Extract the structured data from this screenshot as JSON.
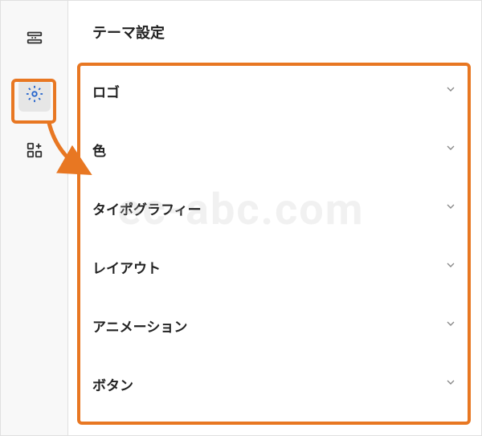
{
  "sidebar": {
    "items": [
      {
        "name": "sections",
        "active": false
      },
      {
        "name": "settings",
        "active": true
      },
      {
        "name": "add-block",
        "active": false
      }
    ]
  },
  "header": {
    "title": "テーマ設定"
  },
  "settings": {
    "items": [
      {
        "label": "ロゴ"
      },
      {
        "label": "色"
      },
      {
        "label": "タイポグラフィー"
      },
      {
        "label": "レイアウト"
      },
      {
        "label": "アニメーション"
      },
      {
        "label": "ボタン"
      }
    ]
  },
  "watermark": "ec-abc.com",
  "annotation": {
    "highlight_color": "#e87722"
  }
}
